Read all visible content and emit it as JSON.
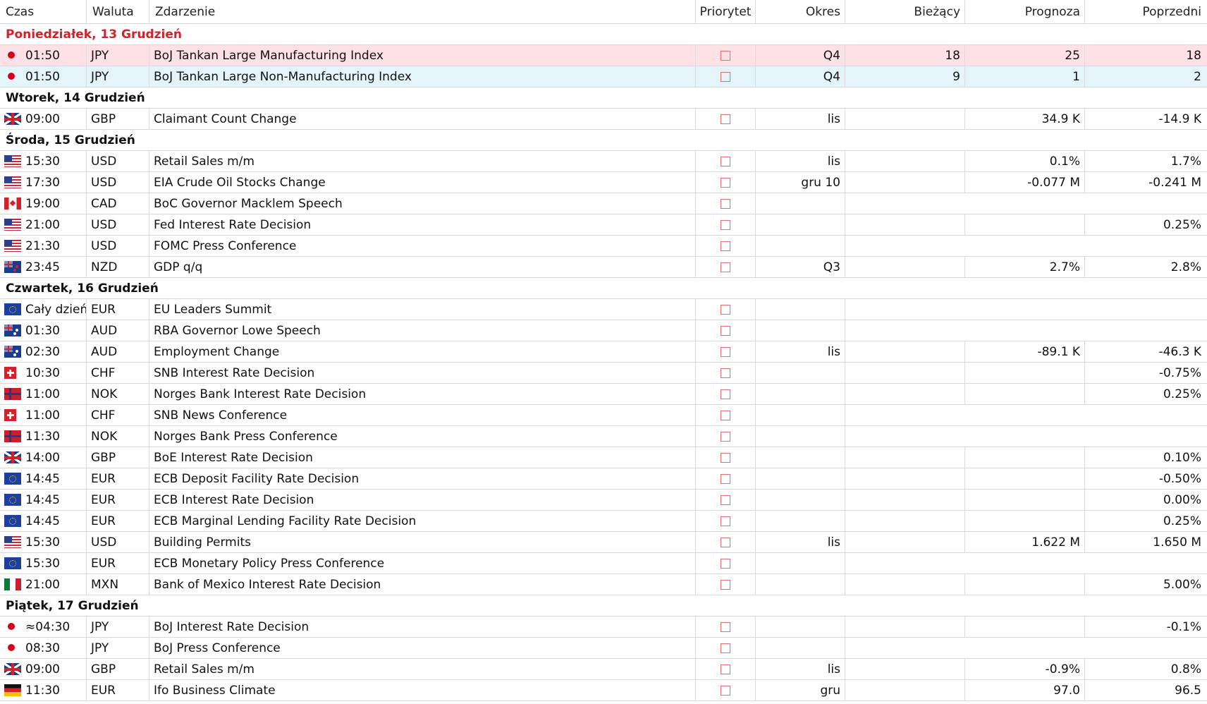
{
  "headers": {
    "time": "Czas",
    "currency": "Waluta",
    "event": "Zdarzenie",
    "priority": "Priorytet",
    "period": "Okres",
    "actual": "Bieżący",
    "forecast": "Prognoza",
    "previous": "Poprzedni"
  },
  "colors": {
    "today_label": "#d0222b",
    "selected_row": "#fde1e4",
    "highlight_row": "#e3f4fb",
    "priority_box": "#e07070"
  },
  "days": [
    {
      "label": "Poniedziałek, 13 Grudzień",
      "today": true,
      "events": [
        {
          "flag": "jp",
          "time": "01:50",
          "currency": "JPY",
          "event": "BoJ Tankan Large Manufacturing Index",
          "period": "Q4",
          "actual": "18",
          "forecast": "25",
          "previous": "18",
          "state": "selected"
        },
        {
          "flag": "jp",
          "time": "01:50",
          "currency": "JPY",
          "event": "BoJ Tankan Large Non-Manufacturing Index",
          "period": "Q4",
          "actual": "9",
          "forecast": "1",
          "previous": "2",
          "state": "highlight"
        }
      ]
    },
    {
      "label": "Wtorek, 14 Grudzień",
      "today": false,
      "events": [
        {
          "flag": "gb",
          "time": "09:00",
          "currency": "GBP",
          "event": "Claimant Count Change",
          "period": "lis",
          "actual": "",
          "forecast": "34.9 K",
          "previous": "-14.9 K"
        }
      ]
    },
    {
      "label": "Środa, 15 Grudzień",
      "today": false,
      "events": [
        {
          "flag": "us",
          "time": "15:30",
          "currency": "USD",
          "event": "Retail Sales m/m",
          "period": "lis",
          "actual": "",
          "forecast": "0.1%",
          "previous": "1.7%"
        },
        {
          "flag": "us",
          "time": "17:30",
          "currency": "USD",
          "event": "EIA Crude Oil Stocks Change",
          "period": "gru 10",
          "actual": "",
          "forecast": "-0.077 M",
          "previous": "-0.241 M"
        },
        {
          "flag": "ca",
          "time": "19:00",
          "currency": "CAD",
          "event": "BoC Governor Macklem Speech",
          "period": "",
          "actual": "",
          "forecast": "",
          "previous": "",
          "merged": true
        },
        {
          "flag": "us",
          "time": "21:00",
          "currency": "USD",
          "event": "Fed Interest Rate Decision",
          "period": "",
          "actual": "",
          "forecast": "",
          "previous": "0.25%"
        },
        {
          "flag": "us",
          "time": "21:30",
          "currency": "USD",
          "event": "FOMC Press Conference",
          "period": "",
          "actual": "",
          "forecast": "",
          "previous": "",
          "merged": true
        },
        {
          "flag": "nz",
          "time": "23:45",
          "currency": "NZD",
          "event": "GDP q/q",
          "period": "Q3",
          "actual": "",
          "forecast": "2.7%",
          "previous": "2.8%"
        }
      ]
    },
    {
      "label": "Czwartek, 16 Grudzień",
      "today": false,
      "events": [
        {
          "flag": "eu",
          "time": "Cały dzień",
          "currency": "EUR",
          "event": "EU Leaders Summit",
          "period": "",
          "actual": "",
          "forecast": "",
          "previous": "",
          "merged": true
        },
        {
          "flag": "au",
          "time": "01:30",
          "currency": "AUD",
          "event": "RBA Governor Lowe Speech",
          "period": "",
          "actual": "",
          "forecast": "",
          "previous": "",
          "merged": true
        },
        {
          "flag": "au",
          "time": "02:30",
          "currency": "AUD",
          "event": "Employment Change",
          "period": "lis",
          "actual": "",
          "forecast": "-89.1 K",
          "previous": "-46.3 K"
        },
        {
          "flag": "ch",
          "time": "10:30",
          "currency": "CHF",
          "event": "SNB Interest Rate Decision",
          "period": "",
          "actual": "",
          "forecast": "",
          "previous": "-0.75%"
        },
        {
          "flag": "no",
          "time": "11:00",
          "currency": "NOK",
          "event": "Norges Bank Interest Rate Decision",
          "period": "",
          "actual": "",
          "forecast": "",
          "previous": "0.25%"
        },
        {
          "flag": "ch",
          "time": "11:00",
          "currency": "CHF",
          "event": "SNB News Conference",
          "period": "",
          "actual": "",
          "forecast": "",
          "previous": "",
          "merged": true
        },
        {
          "flag": "no",
          "time": "11:30",
          "currency": "NOK",
          "event": "Norges Bank Press Conference",
          "period": "",
          "actual": "",
          "forecast": "",
          "previous": "",
          "merged": true
        },
        {
          "flag": "gb",
          "time": "14:00",
          "currency": "GBP",
          "event": "BoE Interest Rate Decision",
          "period": "",
          "actual": "",
          "forecast": "",
          "previous": "0.10%"
        },
        {
          "flag": "eu",
          "time": "14:45",
          "currency": "EUR",
          "event": "ECB Deposit Facility Rate Decision",
          "period": "",
          "actual": "",
          "forecast": "",
          "previous": "-0.50%"
        },
        {
          "flag": "eu",
          "time": "14:45",
          "currency": "EUR",
          "event": "ECB Interest Rate Decision",
          "period": "",
          "actual": "",
          "forecast": "",
          "previous": "0.00%"
        },
        {
          "flag": "eu",
          "time": "14:45",
          "currency": "EUR",
          "event": "ECB Marginal Lending Facility Rate Decision",
          "period": "",
          "actual": "",
          "forecast": "",
          "previous": "0.25%"
        },
        {
          "flag": "us",
          "time": "15:30",
          "currency": "USD",
          "event": "Building Permits",
          "period": "lis",
          "actual": "",
          "forecast": "1.622 M",
          "previous": "1.650 M"
        },
        {
          "flag": "eu",
          "time": "15:30",
          "currency": "EUR",
          "event": "ECB Monetary Policy Press Conference",
          "period": "",
          "actual": "",
          "forecast": "",
          "previous": "",
          "merged": true
        },
        {
          "flag": "mx",
          "time": "21:00",
          "currency": "MXN",
          "event": "Bank of Mexico Interest Rate Decision",
          "period": "",
          "actual": "",
          "forecast": "",
          "previous": "5.00%"
        }
      ]
    },
    {
      "label": "Piątek, 17 Grudzień",
      "today": false,
      "events": [
        {
          "flag": "jp",
          "time": "≈04:30",
          "currency": "JPY",
          "event": "BoJ Interest Rate Decision",
          "period": "",
          "actual": "",
          "forecast": "",
          "previous": "-0.1%"
        },
        {
          "flag": "jp",
          "time": "08:30",
          "currency": "JPY",
          "event": "BoJ Press Conference",
          "period": "",
          "actual": "",
          "forecast": "",
          "previous": "",
          "merged": true
        },
        {
          "flag": "gb",
          "time": "09:00",
          "currency": "GBP",
          "event": "Retail Sales m/m",
          "period": "lis",
          "actual": "",
          "forecast": "-0.9%",
          "previous": "0.8%"
        },
        {
          "flag": "de",
          "time": "11:30",
          "currency": "EUR",
          "event": "Ifo Business Climate",
          "period": "gru",
          "actual": "",
          "forecast": "97.0",
          "previous": "96.5"
        }
      ]
    }
  ]
}
